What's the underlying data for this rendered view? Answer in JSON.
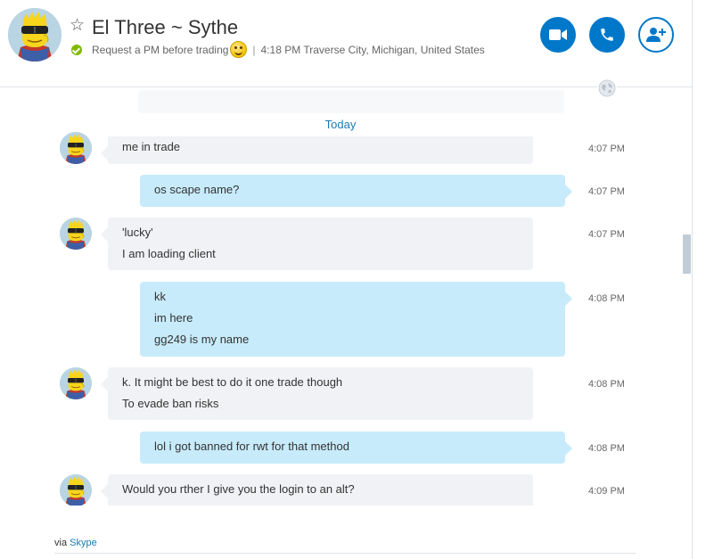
{
  "header": {
    "contact_name": "El Three ~ Sythe",
    "mood": "Request a PM before trading",
    "separator": "|",
    "local_time": "4:18 PM Traverse City, Michigan, United States",
    "icons": {
      "favorite": "star-icon",
      "presence": "online-check-icon",
      "video": "video-call-icon",
      "call": "phone-icon",
      "add": "add-person-icon",
      "mood_emoji": "smiley-icon"
    },
    "accent_color": "#0078ca"
  },
  "chat": {
    "ghost_text": "",
    "day_divider": "Today",
    "messages": [
      {
        "direction": "in",
        "lines": [
          "me in trade"
        ],
        "time": "4:07 PM"
      },
      {
        "direction": "out",
        "lines": [
          "os scape name?"
        ],
        "time": "4:07 PM"
      },
      {
        "direction": "in",
        "lines": [
          "'lucky'",
          "I am loading client"
        ],
        "time": "4:07 PM"
      },
      {
        "direction": "out",
        "lines": [
          "kk",
          "im here",
          "gg249 is my name"
        ],
        "time": "4:08 PM"
      },
      {
        "direction": "in",
        "lines": [
          "k. It might be best to do it one trade though",
          "To evade ban risks"
        ],
        "time": "4:08 PM"
      },
      {
        "direction": "out",
        "lines": [
          "lol i got banned for rwt for that method"
        ],
        "time": "4:08 PM"
      },
      {
        "direction": "in",
        "lines": [
          "Would you rther I give you the login to an alt?"
        ],
        "time": "4:09 PM"
      }
    ]
  },
  "footer": {
    "via_prefix": "via",
    "via_link": "Skype"
  },
  "colors": {
    "incoming_bubble": "#f0f2f5",
    "outgoing_bubble": "#c7ebfb",
    "link": "#1b7ab0",
    "online": "#7fba00"
  }
}
